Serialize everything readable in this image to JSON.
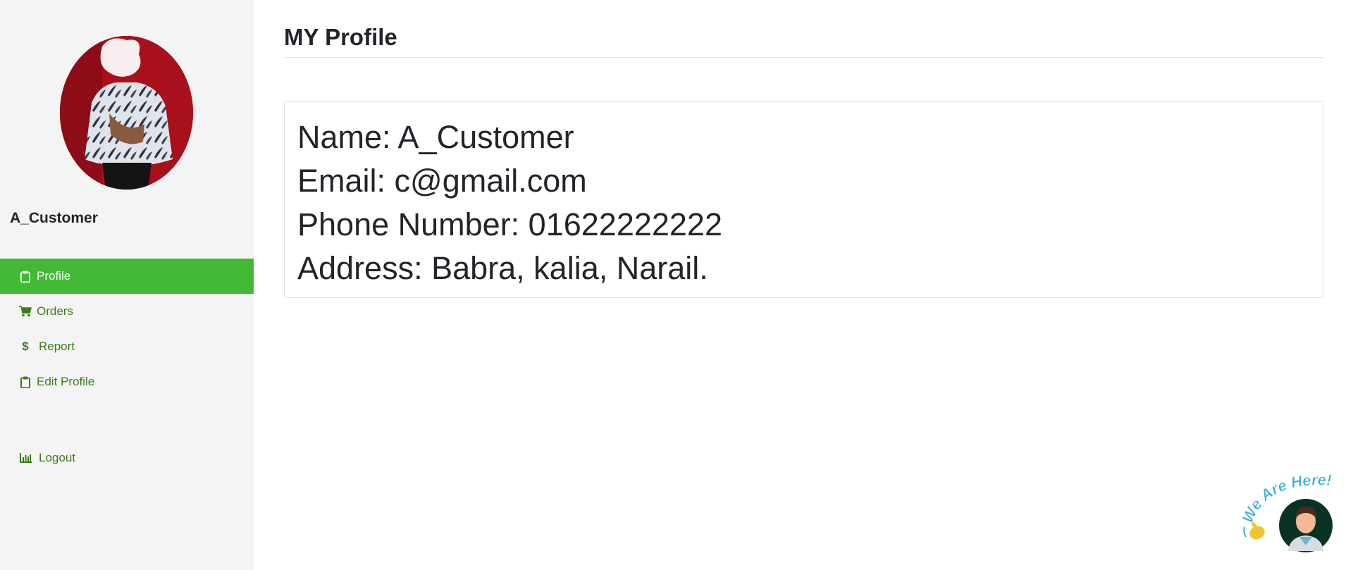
{
  "sidebar": {
    "username": "A_Customer",
    "items": [
      {
        "label": "Profile",
        "icon": "clipboard-icon",
        "active": true
      },
      {
        "label": "Orders",
        "icon": "shopping-cart-icon",
        "active": false
      },
      {
        "label": "Report",
        "icon": "dollar-icon",
        "active": false
      },
      {
        "label": "Edit Profile",
        "icon": "clipboard-icon",
        "active": false
      }
    ],
    "logout_label": "Logout",
    "logout_icon": "bar-chart-icon"
  },
  "main": {
    "title": "MY Profile",
    "profile": {
      "name_line": "Name: A_Customer",
      "email_line": "Email: c@gmail.com",
      "phone_line": "Phone Number: 01622222222",
      "address_line": "Address: Babra, kalia, Narail."
    }
  },
  "chat_widget": {
    "caption": "We Are Here!",
    "icons": [
      "waving-hand-icon",
      "support-agent-avatar-icon"
    ]
  },
  "colors": {
    "sidebar_bg": "#f4f4f4",
    "active_item_bg": "#41b935",
    "nav_text": "#3a7d17",
    "avatar_bg": "#a8101c"
  }
}
